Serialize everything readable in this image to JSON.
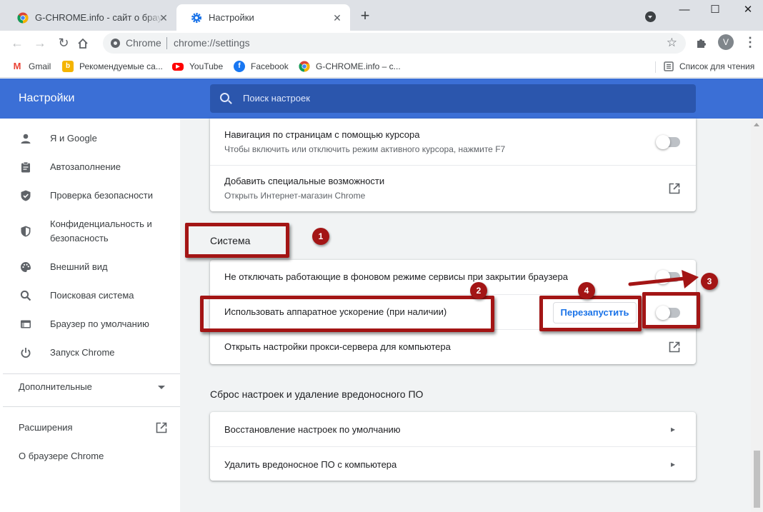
{
  "browser": {
    "tabs": [
      {
        "title": "G-CHROME.info - сайт о браузере Google Chrome",
        "active": false
      },
      {
        "title": "Настройки",
        "active": true
      }
    ],
    "new_tab_label": "+",
    "window_buttons": [
      "—",
      "☐",
      "✕"
    ],
    "omnibox": {
      "site_chip": "Chrome",
      "url": "chrome://settings"
    },
    "profile_initial": "V",
    "bookmarks": [
      {
        "label": "Gmail",
        "icon": "gmail-icon"
      },
      {
        "label": "Рекомендуемые са...",
        "icon": "bing-icon"
      },
      {
        "label": "YouTube",
        "icon": "youtube-icon"
      },
      {
        "label": "Facebook",
        "icon": "facebook-icon"
      },
      {
        "label": "G-CHROME.info – с...",
        "icon": "chrome-icon"
      }
    ],
    "reading_list": "Список для чтения"
  },
  "header": {
    "title": "Настройки",
    "search_placeholder": "Поиск настроек"
  },
  "sidebar": {
    "items": [
      {
        "label": "Я и Google",
        "icon": "person-icon"
      },
      {
        "label": "Автозаполнение",
        "icon": "clipboard-icon"
      },
      {
        "label": "Проверка безопасности",
        "icon": "shield-check-icon"
      },
      {
        "label": "Конфиденциальность и безопасность",
        "icon": "shield-half-icon"
      },
      {
        "label": "Внешний вид",
        "icon": "palette-icon"
      },
      {
        "label": "Поисковая система",
        "icon": "search-icon"
      },
      {
        "label": "Браузер по умолчанию",
        "icon": "browser-window-icon"
      },
      {
        "label": "Запуск Chrome",
        "icon": "power-icon"
      }
    ],
    "advanced": "Дополнительные",
    "extensions": "Расширения",
    "about": "О браузере Chrome"
  },
  "main": {
    "top_card": [
      {
        "title": "Навигация по страницам с помощью курсора",
        "subtitle": "Чтобы включить или отключить режим активного курсора, нажмите F7",
        "control": "toggle-off"
      },
      {
        "title": "Добавить специальные возможности",
        "subtitle": "Открыть Интернет-магазин Chrome",
        "control": "external-link"
      }
    ],
    "system_section": {
      "title": "Система",
      "rows": [
        {
          "title": "Не отключать работающие в фоновом режиме сервисы при закрытии браузера",
          "control": "toggle-off"
        },
        {
          "title": "Использовать аппаратное ускорение (при наличии)",
          "control": "toggle-off",
          "button": "Перезапустить"
        },
        {
          "title": "Открыть настройки прокси-сервера для компьютера",
          "control": "external-link"
        }
      ]
    },
    "reset_section": {
      "title": "Сброс настроек и удаление вредоносного ПО",
      "rows": [
        {
          "title": "Восстановление настроек по умолчанию"
        },
        {
          "title": "Удалить вредоносное ПО с компьютера"
        }
      ]
    }
  },
  "annotations": {
    "badges": [
      "1",
      "2",
      "3",
      "4"
    ],
    "color": "#a31515"
  },
  "colors": {
    "header_blue": "#3b6fd6",
    "search_box": "#2b56ad",
    "link_blue": "#1a73e8"
  }
}
